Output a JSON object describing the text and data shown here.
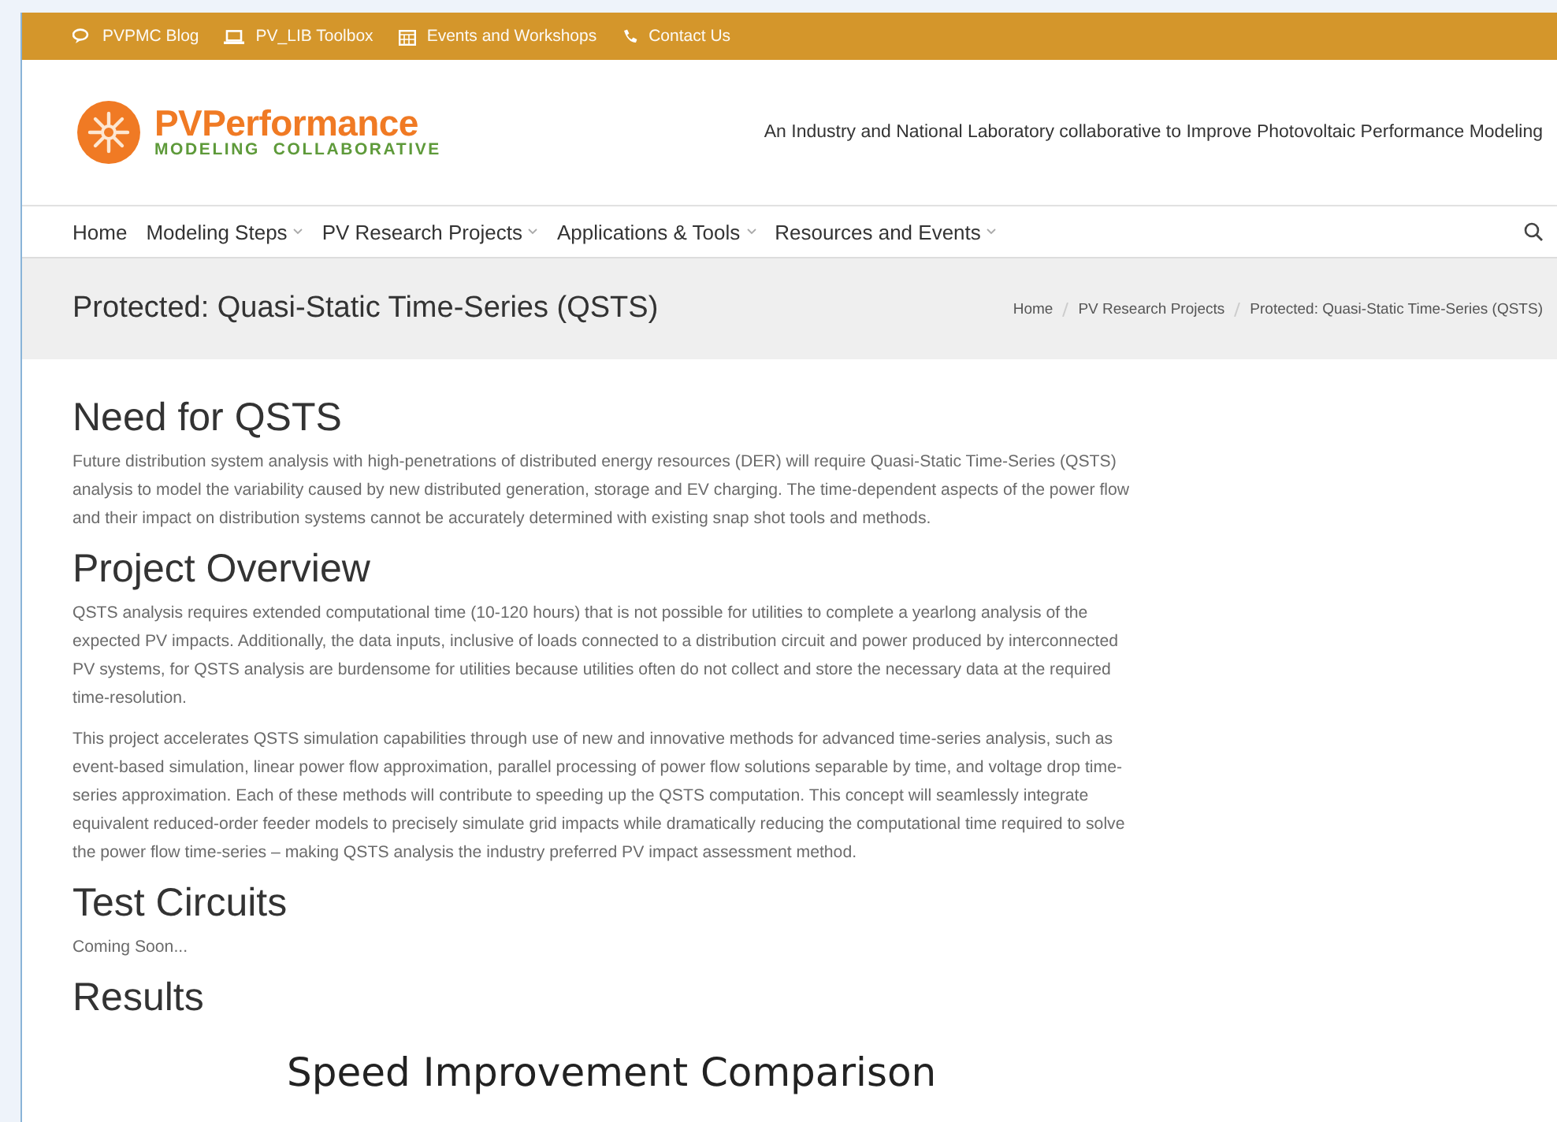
{
  "top_links": [
    {
      "label": "PVPMC Blog"
    },
    {
      "label": "PV_LIB Toolbox"
    },
    {
      "label": "Events and Workshops"
    },
    {
      "label": "Contact Us"
    }
  ],
  "logo": {
    "name": "PVPerformance",
    "subtitle": "MODELING  COLLABORATIVE"
  },
  "tagline": "An Industry and National Laboratory collaborative to Improve Photovoltaic Performance Modeling",
  "nav": [
    {
      "label": "Home",
      "dropdown": false
    },
    {
      "label": "Modeling Steps",
      "dropdown": true
    },
    {
      "label": "PV Research Projects",
      "dropdown": true
    },
    {
      "label": "Applications & Tools",
      "dropdown": true
    },
    {
      "label": "Resources and Events",
      "dropdown": true
    }
  ],
  "page_title": "Protected: Quasi-Static Time-Series (QSTS)",
  "breadcrumb": [
    "Home",
    "PV Research Projects",
    "Protected: Quasi-Static Time-Series (QSTS)"
  ],
  "sections": [
    {
      "heading": "Need for QSTS",
      "paragraphs": [
        "Future distribution system analysis with high-penetrations of distributed energy resources (DER) will require Quasi-Static Time-Series (QSTS) analysis to model the variability caused by new distributed generation, storage and EV charging. The time-dependent aspects of the power flow and their impact on distribution systems cannot be accurately determined with existing snap shot tools and methods."
      ]
    },
    {
      "heading": "Project Overview",
      "paragraphs": [
        "QSTS analysis requires extended computational time (10-120 hours) that is not possible for utilities to complete a yearlong analysis of the expected PV impacts. Additionally, the data inputs, inclusive of loads connected to a distribution circuit and power produced by interconnected PV systems, for QSTS analysis are burdensome for utilities because utilities often do not collect and store the necessary data at the required time-resolution.",
        "This project accelerates QSTS simulation capabilities through use of new and innovative methods for advanced time-series analysis, such as event-based simulation, linear power flow approximation, parallel processing of power flow solutions separable by time, and voltage drop time-series approximation. Each of these methods will contribute to speeding up the QSTS computation. This concept will seamlessly integrate equivalent reduced-order feeder models to precisely simulate grid impacts while dramatically reducing the computational time required to solve the power flow time-series – making QSTS analysis the industry preferred PV impact assessment method."
      ]
    },
    {
      "heading": "Test Circuits",
      "paragraphs": [
        "Coming Soon..."
      ]
    },
    {
      "heading": "Results"
    }
  ],
  "figure_title": "Speed Improvement Comparison"
}
